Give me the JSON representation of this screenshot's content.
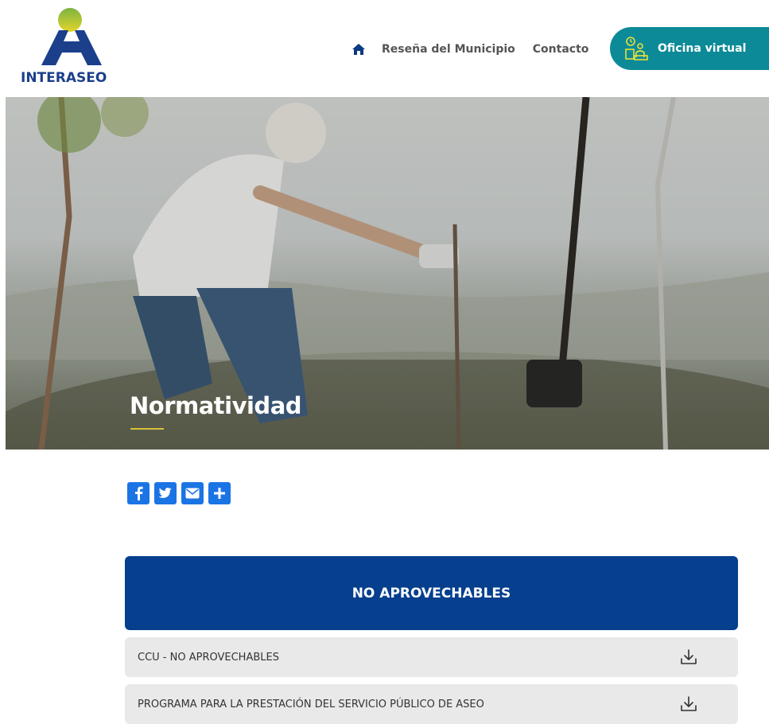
{
  "brand": {
    "name": "INTERASEO",
    "color_primary": "#1b3f8b",
    "color_accent": "#c8c42a"
  },
  "nav": {
    "home_icon": "home-icon",
    "links": [
      "Reseña del Municipio",
      "Contacto"
    ],
    "cta_label": "Oficina virtual",
    "cta_icon": "virtual-office-icon",
    "cta_color": "#0d8a98"
  },
  "hero": {
    "title": "Normatividad"
  },
  "social": {
    "buttons": [
      {
        "name": "facebook",
        "glyph": "f"
      },
      {
        "name": "twitter",
        "glyph": "t"
      },
      {
        "name": "email",
        "glyph": "✉"
      },
      {
        "name": "share",
        "glyph": "+"
      }
    ]
  },
  "section": {
    "title": "NO APROVECHABLES",
    "header_color": "#053f8e",
    "documents": [
      {
        "label": "CCU - NO APROVECHABLES",
        "icon": "download-icon"
      },
      {
        "label": "PROGRAMA PARA LA PRESTACIÓN DEL SERVICIO PÚBLICO DE ASEO",
        "icon": "download-icon"
      }
    ]
  }
}
